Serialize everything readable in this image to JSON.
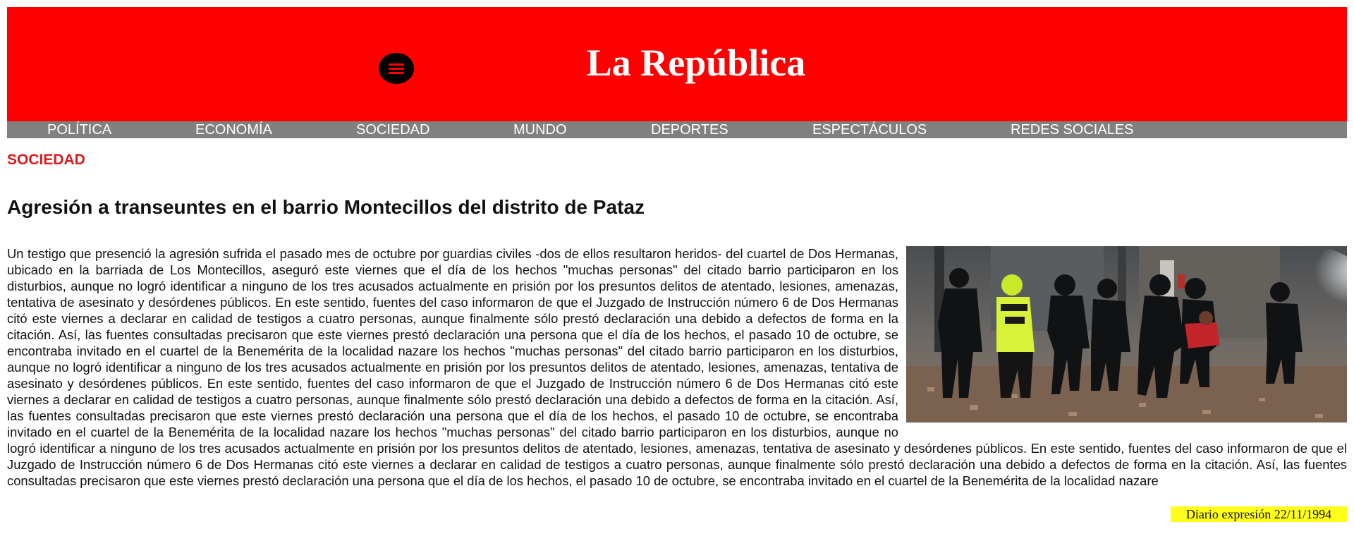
{
  "masthead": {
    "logo": "La República",
    "menu_icon": "hamburger-menu-icon",
    "background_color": "#ff0000"
  },
  "nav": {
    "background_color": "#808080",
    "items": [
      {
        "label": "POLÍTICA"
      },
      {
        "label": "ECONOMÍA"
      },
      {
        "label": "SOCIEDAD"
      },
      {
        "label": "MUNDO"
      },
      {
        "label": "DEPORTES"
      },
      {
        "label": "ESPECTÁCULOS"
      },
      {
        "label": "REDES SOCIALES"
      }
    ]
  },
  "article": {
    "section": "SOCIEDAD",
    "section_color": "#dd1a1a",
    "headline": "Agresión a transeuntes en el barrio Montecillos del distrito de Pataz",
    "body": "Un testigo que presenció la agresión sufrida el pasado mes de octubre por guardias civiles -dos de ellos resultaron heridos- del cuartel de Dos Hermanas, ubicado en la barriada de Los Montecillos, aseguró este viernes que el día de los hechos \"muchas personas\" del citado barrio participaron en los disturbios, aunque no logró identificar a ninguno de los tres acusados actualmente en prisión por los presuntos delitos de atentado, lesiones, amenazas, tentativa de asesinato y desórdenes públicos. En este sentido, fuentes del caso informaron de que el Juzgado de Instrucción número 6 de Dos Hermanas citó este viernes a declarar en calidad de testigos a cuatro personas, aunque finalmente sólo prestó declaración una debido a defectos de forma en la citación. Así, las fuentes consultadas precisaron que este viernes prestó declaración una persona que el día de los hechos, el pasado 10 de octubre, se encontraba invitado en el cuartel de la Benemérita de la localidad nazare los hechos \"muchas personas\" del citado barrio participaron en los disturbios, aunque no logró identificar a ninguno de los tres acusados actualmente en prisión por los presuntos delitos de atentado, lesiones, amenazas, tentativa de asesinato y desórdenes públicos. En este sentido, fuentes del caso informaron de que el Juzgado de Instrucción número 6 de Dos Hermanas citó este viernes a declarar en calidad de testigos a cuatro personas, aunque finalmente sólo prestó declaración una debido a defectos de forma en la citación. Así, las fuentes consultadas precisaron que este viernes prestó declaración una persona que el día de los hechos, el pasado 10 de octubre, se encontraba invitado en el cuartel de la Benemérita de la localidad nazare los hechos \"muchas personas\" del citado barrio participaron en los disturbios, aunque no logró identificar a ninguno de los tres acusados actualmente en prisión por los presuntos delitos de atentado, lesiones, amenazas, tentativa de asesinato y desórdenes públicos. En este sentido, fuentes del caso informaron de que el Juzgado de Instrucción número 6 de Dos Hermanas citó este viernes a declarar en calidad de testigos a cuatro personas, aunque finalmente sólo prestó declaración una debido a defectos de forma en la citación. Así, las fuentes consultadas precisaron que este viernes prestó declaración una persona que el día de los hechos, el pasado 10 de octubre, se encontraba invitado en el cuartel de la Benemérita de la localidad nazare",
    "photo_vest_text": "POLICIA",
    "photo_badge_text": "28676",
    "photo_vest_color": "#d8f23a"
  },
  "footer": {
    "stamp": "Diario expresión 22/11/1994",
    "stamp_color": "#ffff1a"
  }
}
